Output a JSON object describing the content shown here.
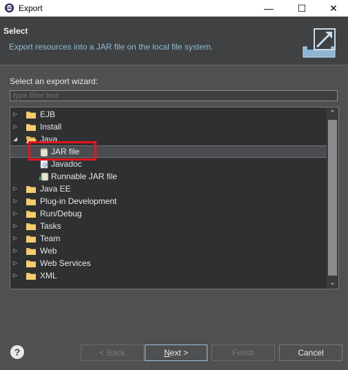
{
  "window": {
    "title": "Export"
  },
  "banner": {
    "heading": "Select",
    "description": "Export resources into a JAR file on the local file system."
  },
  "wizard": {
    "label": "Select an export wizard:",
    "filter_placeholder": "type filter text",
    "tree": [
      {
        "label": "EJB",
        "type": "folder",
        "expanded": false,
        "depth": 0,
        "icon": "folder-icon"
      },
      {
        "label": "Install",
        "type": "folder",
        "expanded": false,
        "depth": 0,
        "icon": "folder-icon"
      },
      {
        "label": "Java",
        "type": "folder",
        "expanded": true,
        "depth": 0,
        "icon": "folder-open-icon"
      },
      {
        "label": "JAR file",
        "type": "item",
        "depth": 1,
        "icon": "jar-icon",
        "selected": true
      },
      {
        "label": "Javadoc",
        "type": "item",
        "depth": 1,
        "icon": "javadoc-icon"
      },
      {
        "label": "Runnable JAR file",
        "type": "item",
        "depth": 1,
        "icon": "runnable-jar-icon"
      },
      {
        "label": "Java EE",
        "type": "folder",
        "expanded": false,
        "depth": 0,
        "icon": "folder-icon"
      },
      {
        "label": "Plug-in Development",
        "type": "folder",
        "expanded": false,
        "depth": 0,
        "icon": "folder-icon"
      },
      {
        "label": "Run/Debug",
        "type": "folder",
        "expanded": false,
        "depth": 0,
        "icon": "folder-icon"
      },
      {
        "label": "Tasks",
        "type": "folder",
        "expanded": false,
        "depth": 0,
        "icon": "folder-icon"
      },
      {
        "label": "Team",
        "type": "folder",
        "expanded": false,
        "depth": 0,
        "icon": "folder-icon"
      },
      {
        "label": "Web",
        "type": "folder",
        "expanded": false,
        "depth": 0,
        "icon": "folder-icon"
      },
      {
        "label": "Web Services",
        "type": "folder",
        "expanded": false,
        "depth": 0,
        "icon": "folder-icon"
      },
      {
        "label": "XML",
        "type": "folder",
        "expanded": false,
        "depth": 0,
        "icon": "folder-icon"
      }
    ]
  },
  "buttons": {
    "back": "< Back",
    "next_mnemonic": "N",
    "next_rest": "ext >",
    "finish": "Finish",
    "cancel": "Cancel"
  },
  "colors": {
    "highlight": "#e8141c",
    "background": "#4f5052",
    "banner": "#3f4143",
    "tree_background": "#2f3032",
    "description_text": "#8fbcd4"
  }
}
